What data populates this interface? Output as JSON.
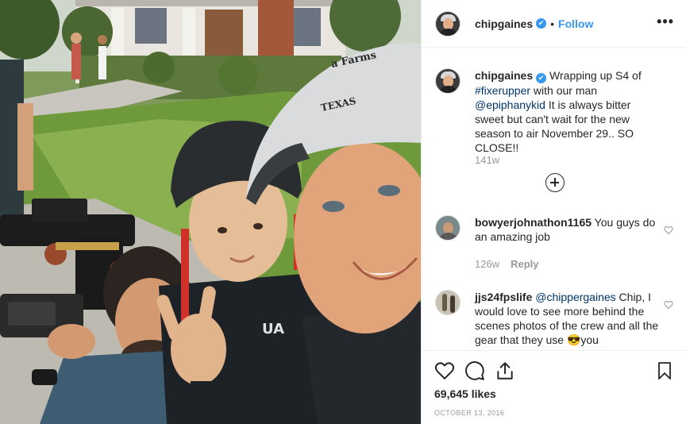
{
  "post": {
    "author": "chipgaines",
    "verified_mark": "✔",
    "separator": "•",
    "follow_label": "Follow",
    "more_label": "•••"
  },
  "photo": {
    "cap_text_line1": "a Farms",
    "cap_text_line2": "TEXAS",
    "shirt_logo": "UA"
  },
  "caption": {
    "author": "chipgaines",
    "text_before_tag": " Wrapping up S4 of ",
    "hashtag": "#fixerupper",
    "text_mid": " with our man ",
    "mention": "@epiphanykid",
    "text_after": " It is always bitter sweet but can't wait for the new season to air November 29.. SO CLOSE!!",
    "age": "141w"
  },
  "comments": [
    {
      "author": "bowyerjohnathon1165",
      "text": " You guys do an amazing job",
      "age": "126w",
      "reply_label": "Reply"
    },
    {
      "author": "jjs24fpslife",
      "mention": " @chippergaines",
      "text": " Chip, I would love to see more behind the scenes photos of the crew and all the gear that they use 😎you"
    }
  ],
  "icons": {
    "like": "heart-icon",
    "comment": "comment-icon",
    "share": "share-icon",
    "save": "bookmark-icon",
    "more_comments": "plus-circle-icon"
  },
  "stats": {
    "likes": "69,645 likes",
    "date": "OCTOBER 13, 2016"
  },
  "colors": {
    "link": "#003569",
    "follow": "#3897f0",
    "verified": "#3897f0",
    "muted": "#999999"
  }
}
